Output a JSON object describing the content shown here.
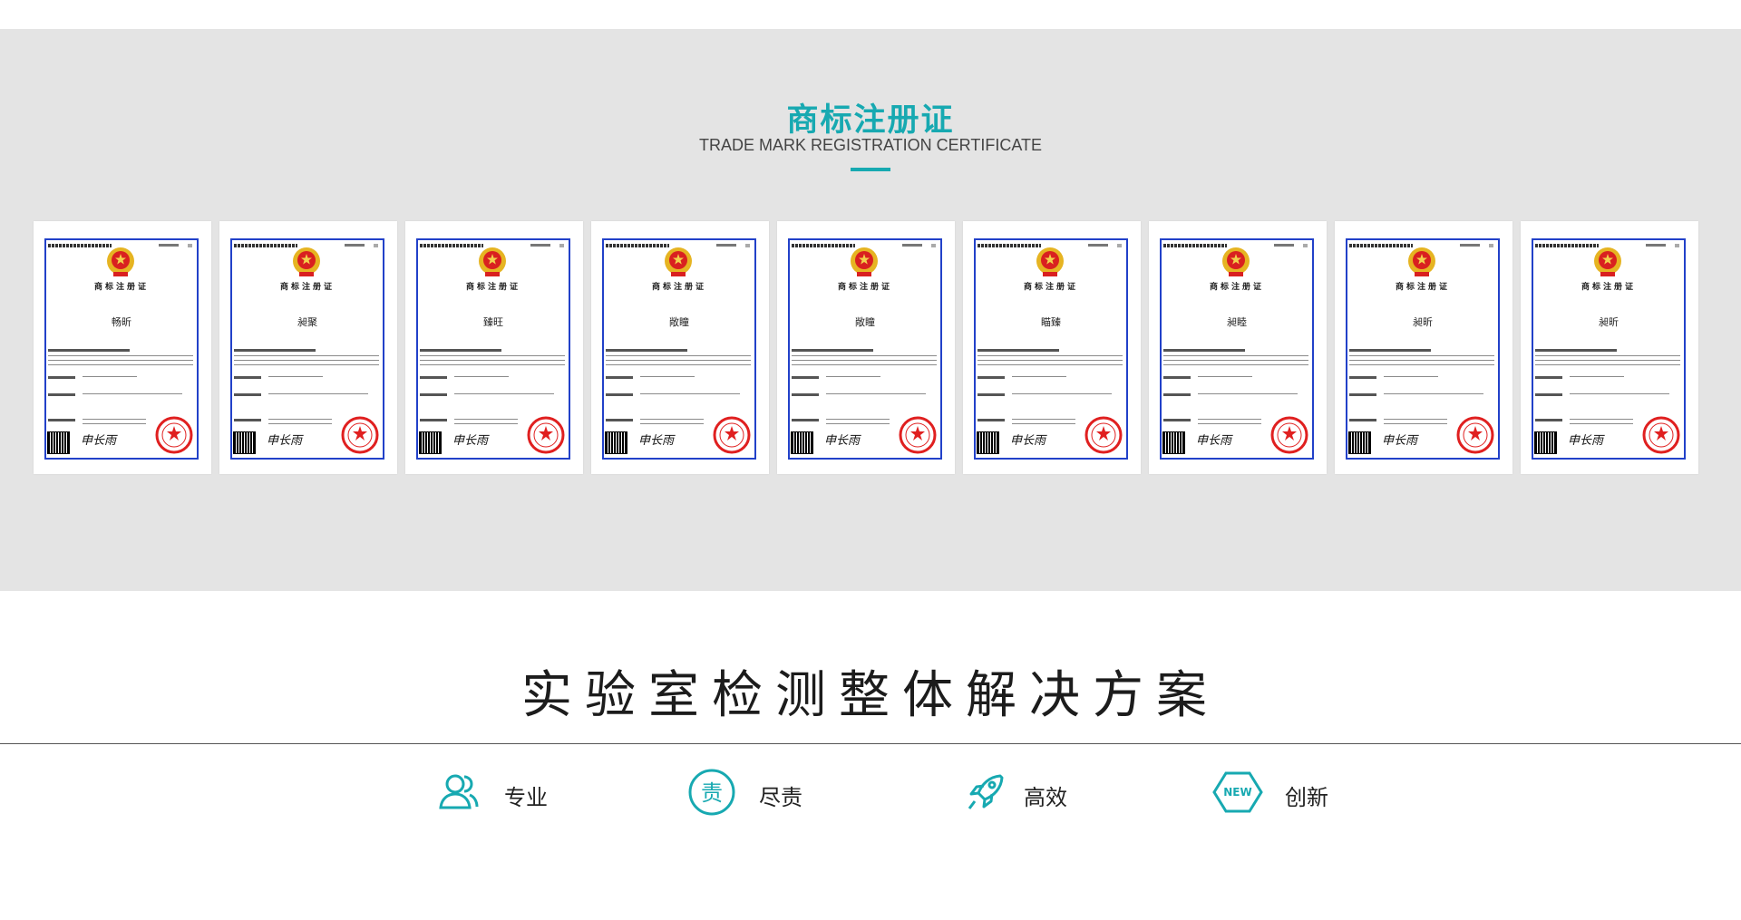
{
  "certificates_section": {
    "title": "商标注册证",
    "subtitle": "TRADE MARK REGISTRATION CERTIFICATE",
    "certificates": [
      {
        "heading": "商标注册证",
        "brand": "畅昕",
        "signature": "申长雨"
      },
      {
        "heading": "商标注册证",
        "brand": "昶聚",
        "signature": "申长雨"
      },
      {
        "heading": "商标注册证",
        "brand": "臻旺",
        "signature": "申长雨"
      },
      {
        "heading": "商标注册证",
        "brand": "敞瞳",
        "signature": "申长雨"
      },
      {
        "heading": "商标注册证",
        "brand": "敞瞳",
        "signature": "申长雨"
      },
      {
        "heading": "商标注册证",
        "brand": "瞄臻",
        "signature": "申长雨"
      },
      {
        "heading": "商标注册证",
        "brand": "昶睦",
        "signature": "申长雨"
      },
      {
        "heading": "商标注册证",
        "brand": "昶昕",
        "signature": "申长雨"
      },
      {
        "heading": "商标注册证",
        "brand": "昶昕",
        "signature": "申长雨"
      }
    ]
  },
  "solutions": {
    "title": "实验室检测整体解决方案",
    "features": [
      {
        "label": "专业",
        "icon": "users-icon"
      },
      {
        "label": "尽责",
        "icon": "responsibility-icon",
        "icon_text": "责"
      },
      {
        "label": "高效",
        "icon": "rocket-icon"
      },
      {
        "label": "创新",
        "icon": "new-hexagon-icon",
        "icon_text": "NEW"
      }
    ]
  },
  "colors": {
    "accent": "#17a9b1",
    "band_background": "#e4e4e4",
    "certificate_border": "#2241c9",
    "seal_red": "#e02020"
  }
}
